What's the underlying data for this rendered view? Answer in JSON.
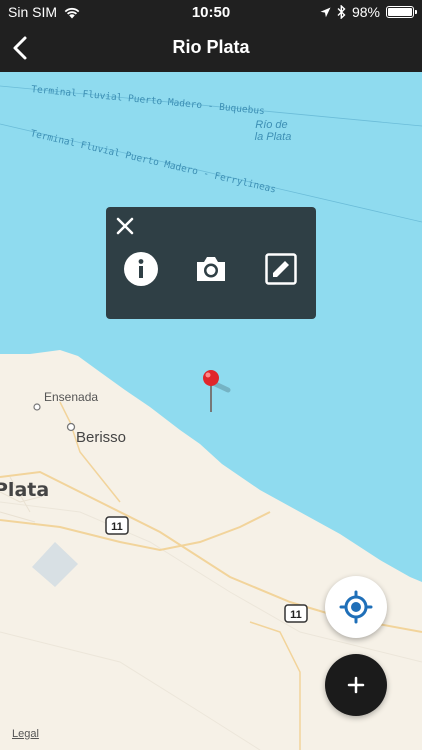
{
  "status_bar": {
    "carrier": "Sin SIM",
    "time": "10:50",
    "battery": "98%",
    "battery_level": 0.98,
    "icons": [
      "wifi-icon",
      "location-arrow-icon",
      "bluetooth-icon",
      "battery-icon"
    ]
  },
  "nav": {
    "title": "Rio Plata",
    "back_icon": "chevron-left-icon"
  },
  "map": {
    "water_label": "Río de la Plata",
    "water_label_line1": "Río de",
    "water_label_line2": "la Plata",
    "ferry_routes": [
      "Terminal Fluvial Puerto Madero - Buquebus",
      "Terminal Fluvial Puerto Madero - Ferrylineas"
    ],
    "places": [
      "Ensenada",
      "Berisso",
      "Plata"
    ],
    "road_shields": [
      "11",
      "11"
    ],
    "pin_icon": "map-pin-icon",
    "colors": {
      "water": "#8fdbef",
      "land": "#f6f1e7",
      "pin": "#e0262b",
      "road": "#f2d49b"
    }
  },
  "popup": {
    "close_icon": "close-icon",
    "actions": [
      {
        "name": "info",
        "icon": "info-icon"
      },
      {
        "name": "camera",
        "icon": "camera-icon"
      },
      {
        "name": "edit",
        "icon": "edit-icon"
      }
    ],
    "background": "#2f3f45"
  },
  "fabs": {
    "locate_icon": "crosshair-icon",
    "add_icon": "plus-icon",
    "accent": "#1f6fb8"
  },
  "legal": "Legal"
}
